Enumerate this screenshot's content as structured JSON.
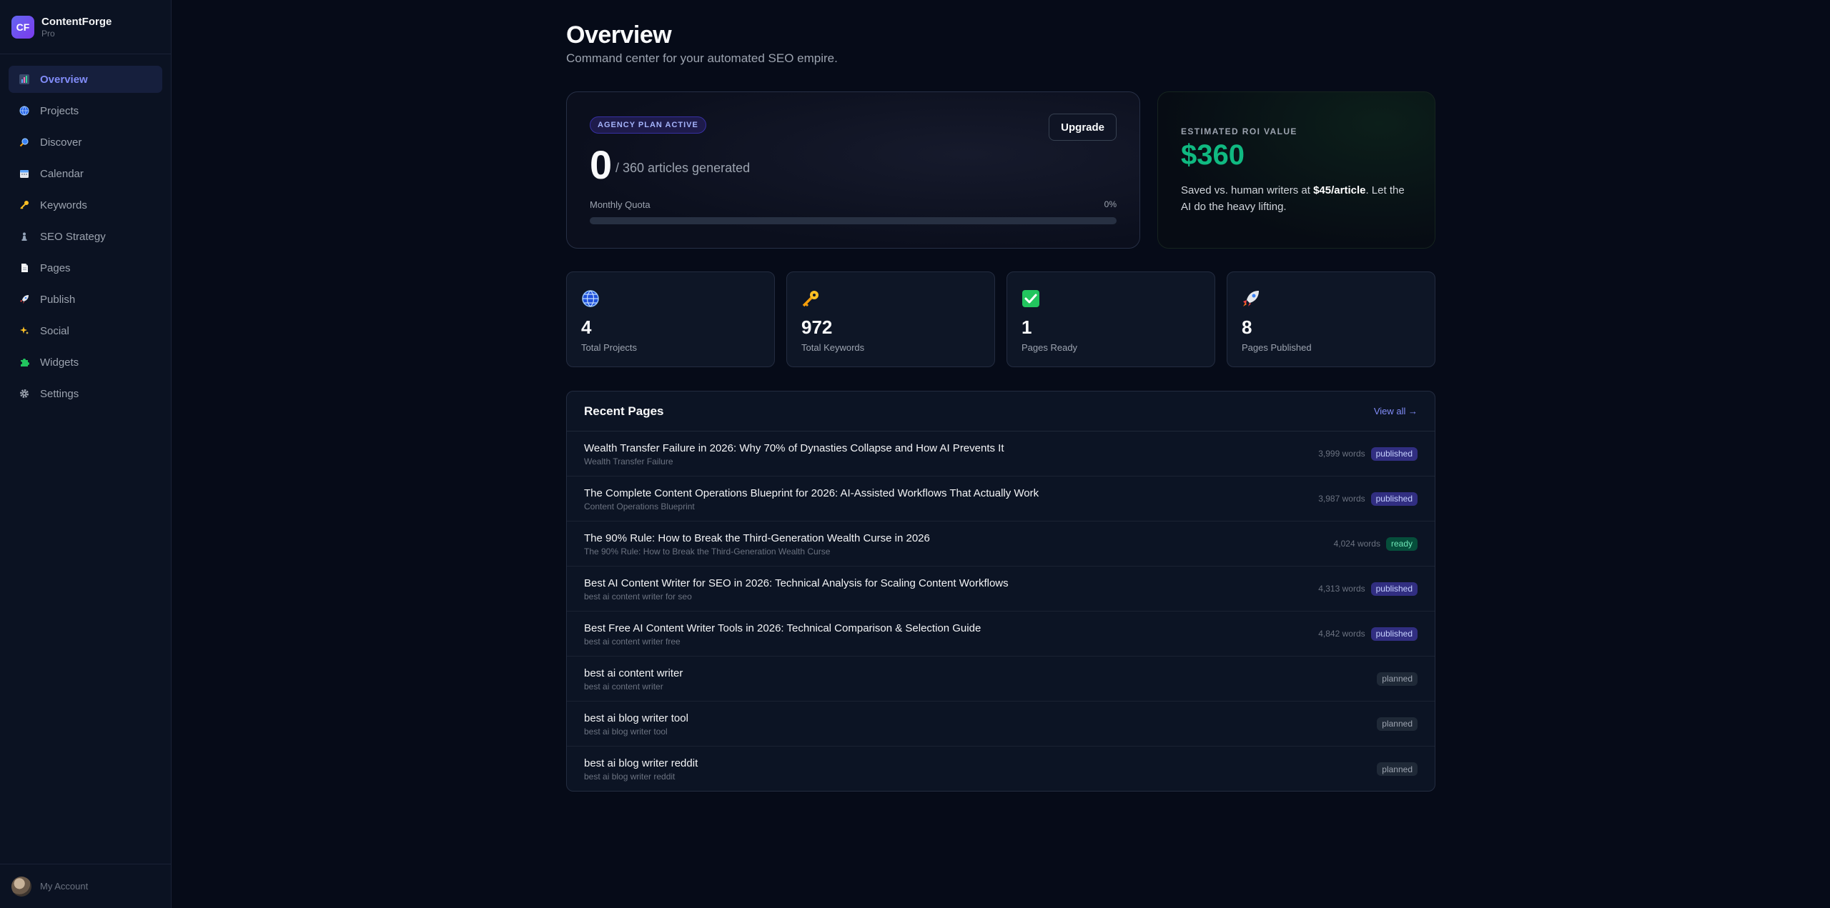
{
  "brand": {
    "logo": "CF",
    "name": "ContentForge",
    "plan": "Pro"
  },
  "sidebar": {
    "items": [
      {
        "label": "Overview",
        "icon": "bar-chart-icon",
        "active": true
      },
      {
        "label": "Projects",
        "icon": "globe-icon"
      },
      {
        "label": "Discover",
        "icon": "magnifier-icon"
      },
      {
        "label": "Calendar",
        "icon": "calendar-icon"
      },
      {
        "label": "Keywords",
        "icon": "key-icon"
      },
      {
        "label": "SEO Strategy",
        "icon": "chess-pawn-icon"
      },
      {
        "label": "Pages",
        "icon": "page-icon"
      },
      {
        "label": "Publish",
        "icon": "rocket-icon"
      },
      {
        "label": "Social",
        "icon": "sparkles-icon"
      },
      {
        "label": "Widgets",
        "icon": "puzzle-icon"
      },
      {
        "label": "Settings",
        "icon": "gear-icon"
      }
    ],
    "account_label": "My Account"
  },
  "header": {
    "title": "Overview",
    "subtitle": "Command center for your automated SEO empire."
  },
  "plan": {
    "badge": "AGENCY PLAN ACTIVE",
    "upgrade_label": "Upgrade",
    "generated": "0",
    "limit_text": "/ 360 articles generated",
    "quota_label": "Monthly Quota",
    "quota_pct_text": "0%",
    "quota_fraction": 0
  },
  "roi": {
    "label": "ESTIMATED ROI VALUE",
    "value": "$360",
    "desc_pre": "Saved vs. human writers at ",
    "desc_bold": "$45/article",
    "desc_post": ". Let the AI do the heavy lifting."
  },
  "stats": [
    {
      "value": "4",
      "label": "Total Projects",
      "icon": "globe-icon"
    },
    {
      "value": "972",
      "label": "Total Keywords",
      "icon": "key-icon"
    },
    {
      "value": "1",
      "label": "Pages Ready",
      "icon": "check-box-icon"
    },
    {
      "value": "8",
      "label": "Pages Published",
      "icon": "rocket-icon"
    }
  ],
  "recent": {
    "title": "Recent Pages",
    "view_all": "View all →",
    "rows": [
      {
        "title": "Wealth Transfer Failure in 2026: Why 70% of Dynasties Collapse and How AI Prevents It",
        "sub": "Wealth Transfer Failure",
        "words": "3,999 words",
        "status": "published"
      },
      {
        "title": "The Complete Content Operations Blueprint for 2026: AI-Assisted Workflows That Actually Work",
        "sub": "Content Operations Blueprint",
        "words": "3,987 words",
        "status": "published"
      },
      {
        "title": "The 90% Rule: How to Break the Third-Generation Wealth Curse in 2026",
        "sub": "The 90% Rule: How to Break the Third-Generation Wealth Curse",
        "words": "4,024 words",
        "status": "ready"
      },
      {
        "title": "Best AI Content Writer for SEO in 2026: Technical Analysis for Scaling Content Workflows",
        "sub": "best ai content writer for seo",
        "words": "4,313 words",
        "status": "published"
      },
      {
        "title": "Best Free AI Content Writer Tools in 2026: Technical Comparison & Selection Guide",
        "sub": "best ai content writer free",
        "words": "4,842 words",
        "status": "published"
      },
      {
        "title": "best ai content writer",
        "sub": "best ai content writer",
        "words": "",
        "status": "planned"
      },
      {
        "title": "best ai blog writer tool",
        "sub": "best ai blog writer tool",
        "words": "",
        "status": "planned"
      },
      {
        "title": "best ai blog writer reddit",
        "sub": "best ai blog writer reddit",
        "words": "",
        "status": "planned"
      }
    ]
  },
  "colors": {
    "accent": "#6366f1",
    "roi_green": "#10b981",
    "background": "#060b18"
  }
}
